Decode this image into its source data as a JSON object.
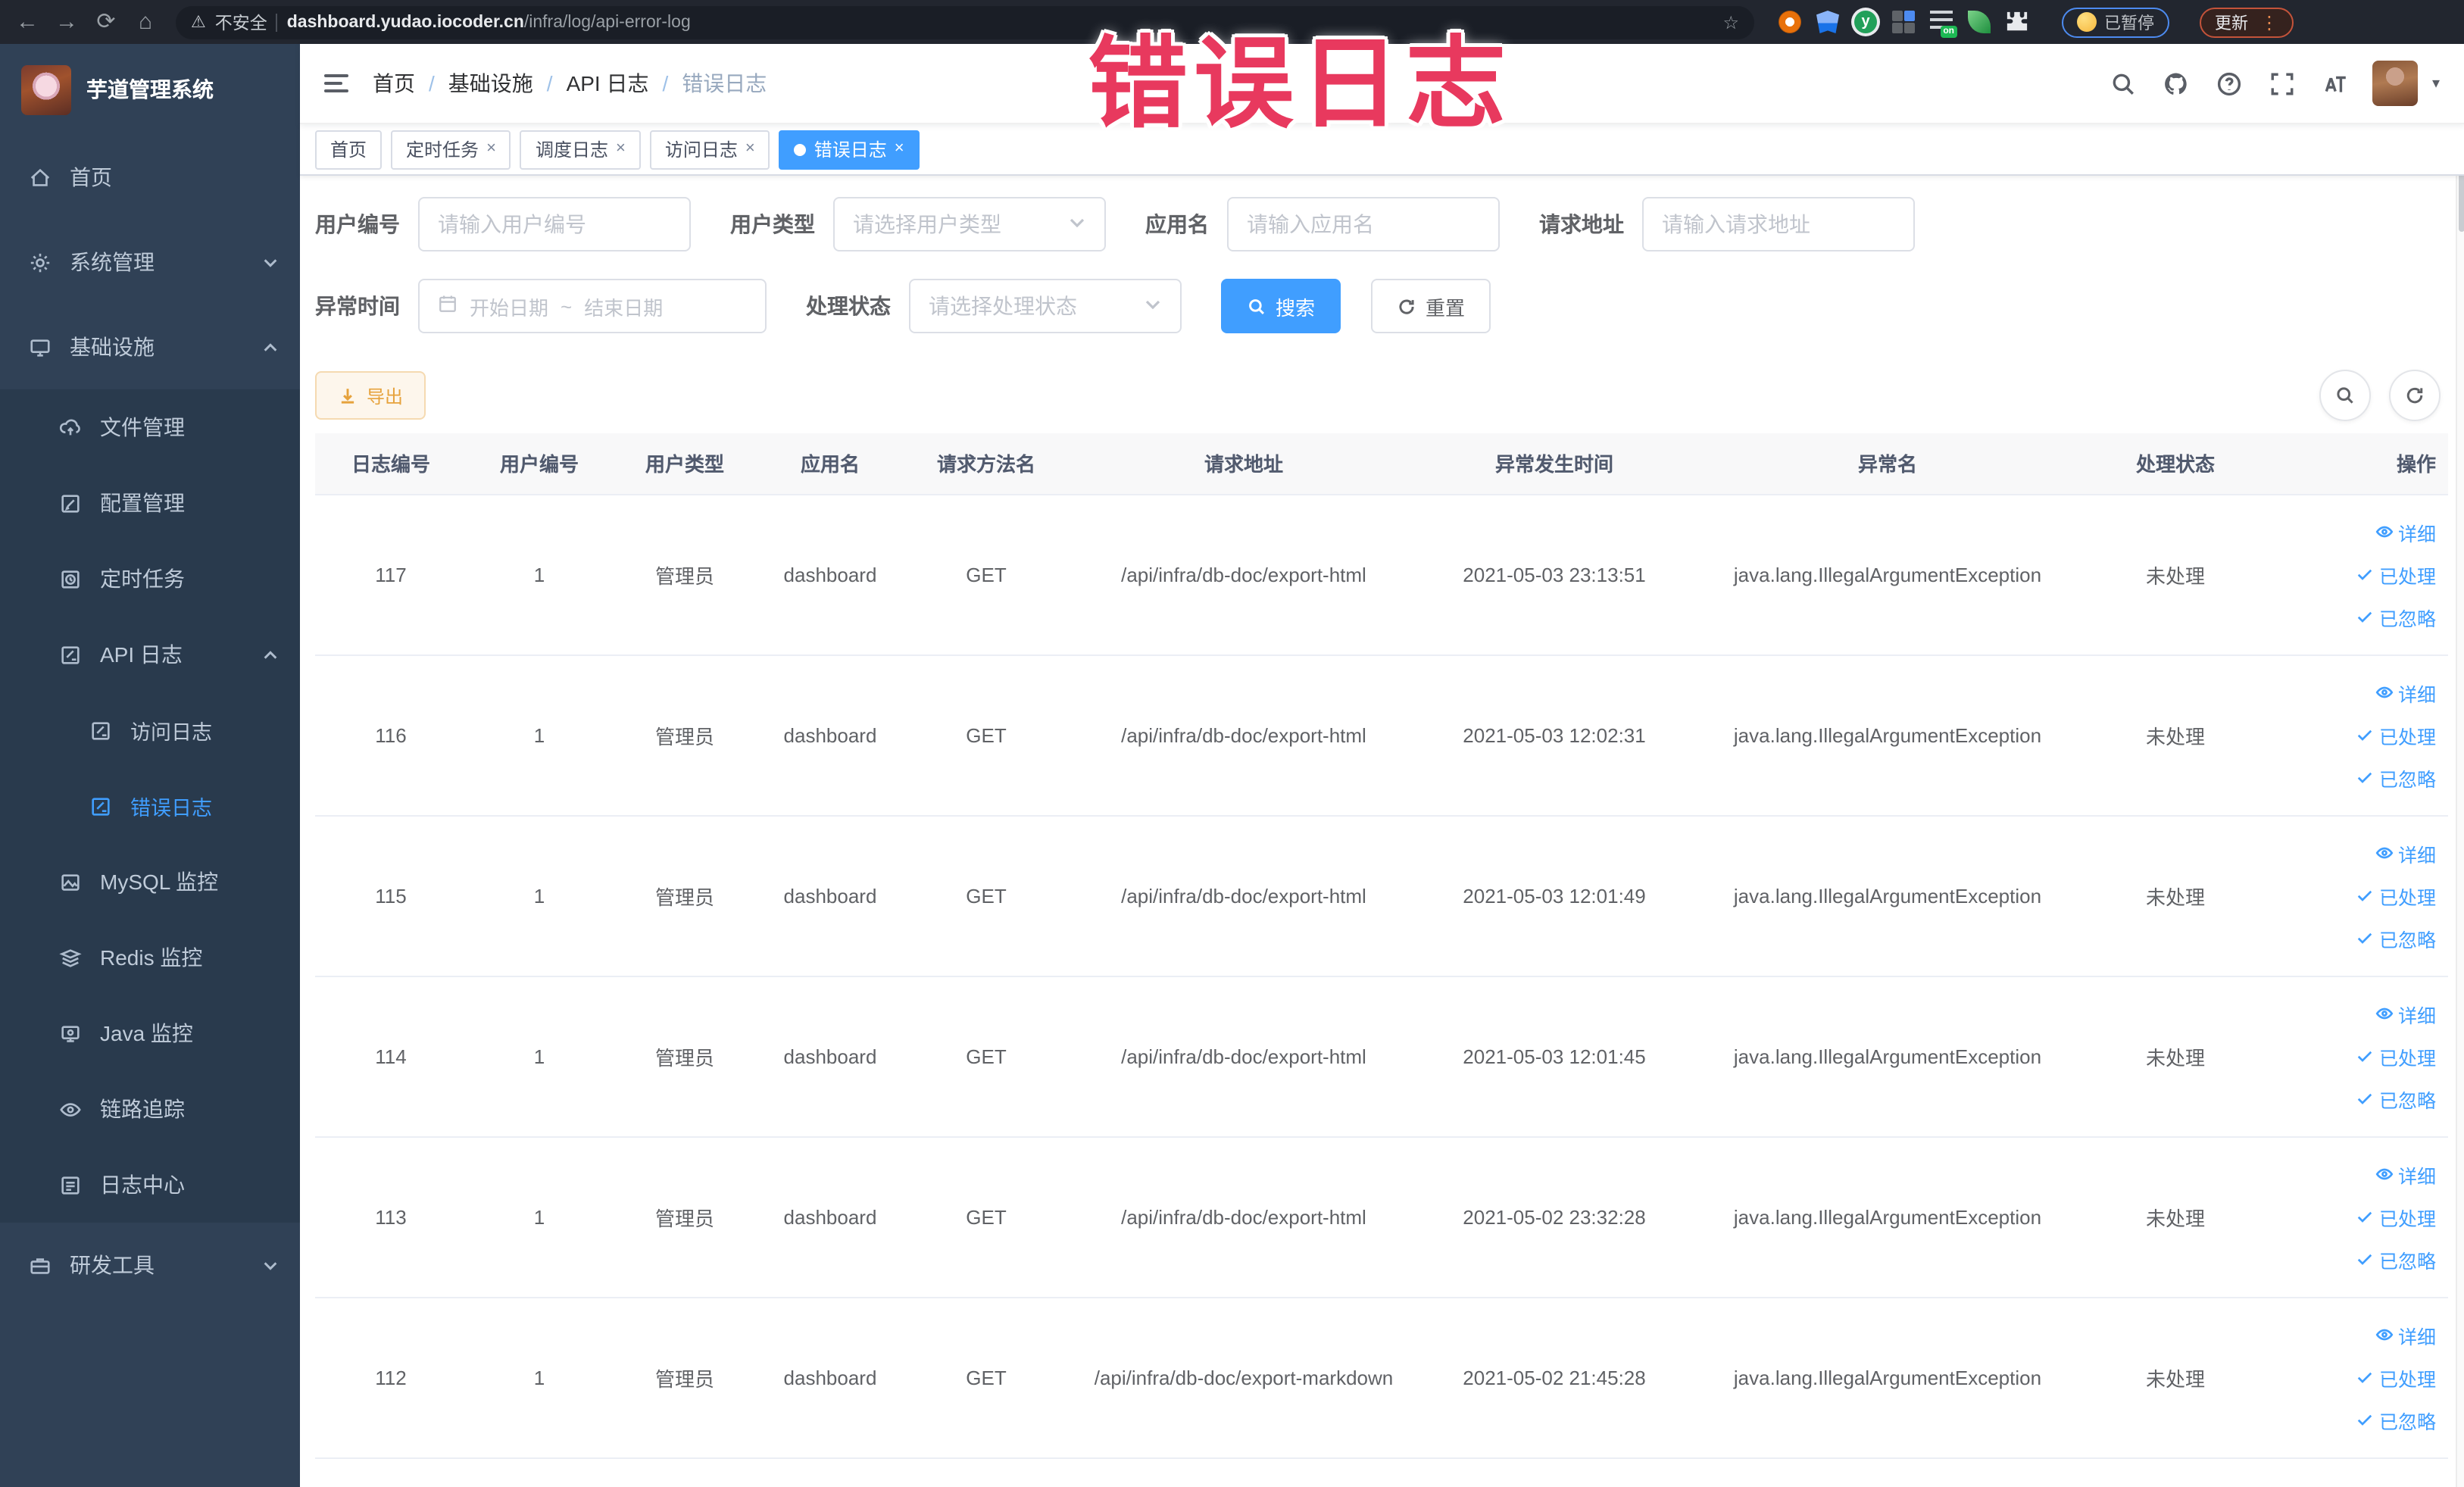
{
  "colors": {
    "accent": "#409eff",
    "warning": "#e6a23c",
    "overlay_red": "#e8395e",
    "sidebar_bg": "#304156",
    "submenu_bg": "#293a4d"
  },
  "overlay": {
    "text": "错误日志"
  },
  "browser": {
    "security_label": "不安全",
    "url_host": "dashboard.yudao.iocoder.cn",
    "url_path": "/infra/log/api-error-log",
    "extension_badge": "on",
    "paused_chip": "已暂停",
    "update_chip": "更新"
  },
  "icons": {
    "back": "←",
    "forward": "→",
    "reload": "⟳",
    "home": "⌂",
    "warning": "⚠",
    "star": "☆",
    "kebab": "⋮",
    "caret_down": "▾",
    "close": "×",
    "ext_green_letter": "y",
    "date_separator": "~"
  },
  "sidebar": {
    "title": "芋道管理系统",
    "home": "首页",
    "system": "系统管理",
    "infra": "基础设施",
    "file": "文件管理",
    "config": "配置管理",
    "job": "定时任务",
    "apilog": "API 日志",
    "accesslog": "访问日志",
    "errorlog": "错误日志",
    "mysql": "MySQL 监控",
    "redis": "Redis 监控",
    "java": "Java 监控",
    "trace": "链路追踪",
    "logcenter": "日志中心",
    "devtool": "研发工具"
  },
  "breadcrumb": {
    "separator": "/",
    "items": [
      "首页",
      "基础设施",
      "API 日志",
      "错误日志"
    ]
  },
  "tabs": {
    "items": [
      {
        "label": "首页"
      },
      {
        "label": "定时任务"
      },
      {
        "label": "调度日志"
      },
      {
        "label": "访问日志"
      },
      {
        "label": "错误日志"
      }
    ]
  },
  "filters": {
    "user_id_label": "用户编号",
    "user_id_placeholder": "请输入用户编号",
    "user_type_label": "用户类型",
    "user_type_placeholder": "请选择用户类型",
    "app_name_label": "应用名",
    "app_name_placeholder": "请输入应用名",
    "request_url_label": "请求地址",
    "request_url_placeholder": "请输入请求地址",
    "time_label": "异常时间",
    "time_start_placeholder": "开始日期",
    "time_end_placeholder": "结束日期",
    "status_label": "处理状态",
    "status_placeholder": "请选择处理状态",
    "search_button": "搜索",
    "reset_button": "重置"
  },
  "toolbar": {
    "export_button": "导出"
  },
  "table": {
    "columns": [
      "日志编号",
      "用户编号",
      "用户类型",
      "应用名",
      "请求方法名",
      "请求地址",
      "异常发生时间",
      "异常名",
      "处理状态",
      "操作"
    ],
    "ops": [
      "详细",
      "已处理",
      "已忽略"
    ],
    "rows": [
      {
        "id": "117",
        "user_id": "1",
        "user_type": "管理员",
        "app": "dashboard",
        "method": "GET",
        "url": "/api/infra/db-doc/export-html",
        "time": "2021-05-03 23:13:51",
        "exception": "java.lang.IllegalArgumentException",
        "status": "未处理"
      },
      {
        "id": "116",
        "user_id": "1",
        "user_type": "管理员",
        "app": "dashboard",
        "method": "GET",
        "url": "/api/infra/db-doc/export-html",
        "time": "2021-05-03 12:02:31",
        "exception": "java.lang.IllegalArgumentException",
        "status": "未处理"
      },
      {
        "id": "115",
        "user_id": "1",
        "user_type": "管理员",
        "app": "dashboard",
        "method": "GET",
        "url": "/api/infra/db-doc/export-html",
        "time": "2021-05-03 12:01:49",
        "exception": "java.lang.IllegalArgumentException",
        "status": "未处理"
      },
      {
        "id": "114",
        "user_id": "1",
        "user_type": "管理员",
        "app": "dashboard",
        "method": "GET",
        "url": "/api/infra/db-doc/export-html",
        "time": "2021-05-03 12:01:45",
        "exception": "java.lang.IllegalArgumentException",
        "status": "未处理"
      },
      {
        "id": "113",
        "user_id": "1",
        "user_type": "管理员",
        "app": "dashboard",
        "method": "GET",
        "url": "/api/infra/db-doc/export-html",
        "time": "2021-05-02 23:32:28",
        "exception": "java.lang.IllegalArgumentException",
        "status": "未处理"
      },
      {
        "id": "112",
        "user_id": "1",
        "user_type": "管理员",
        "app": "dashboard",
        "method": "GET",
        "url": "/api/infra/db-doc/export-markdown",
        "time": "2021-05-02 21:45:28",
        "exception": "java.lang.IllegalArgumentException",
        "status": "未处理"
      }
    ]
  }
}
